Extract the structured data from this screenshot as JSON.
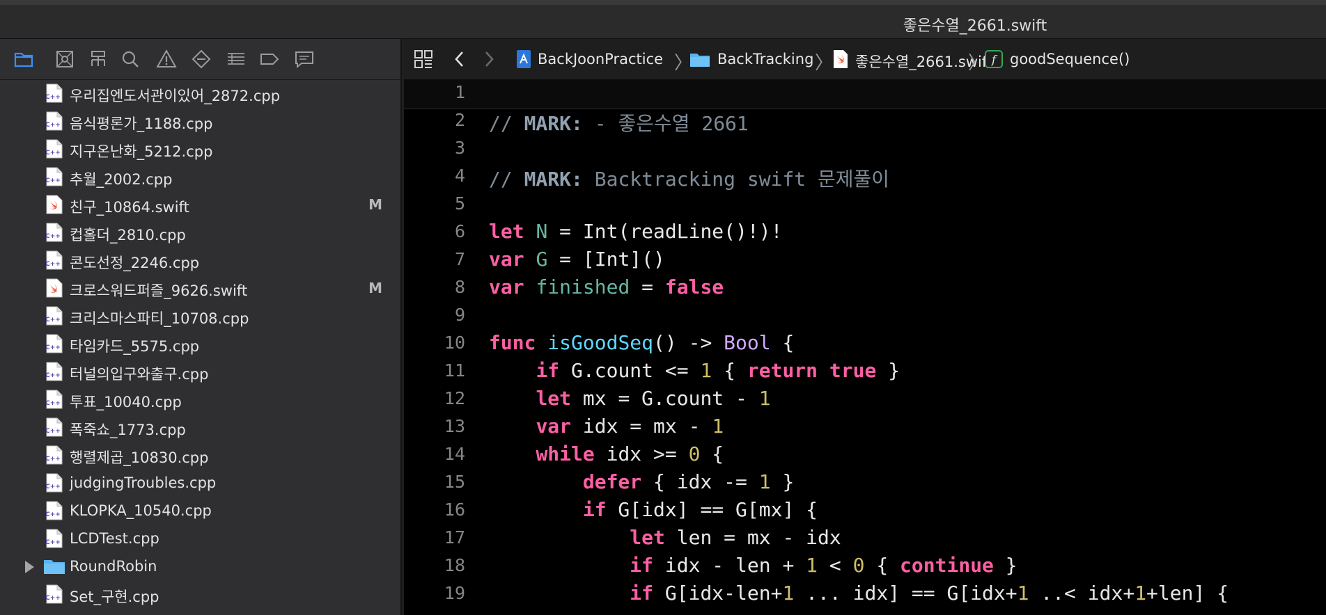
{
  "window": {
    "title": "좋은수열_2661.swift"
  },
  "navigator": {
    "tabs": [
      "project-navigator",
      "source-control-navigator",
      "symbol-navigator",
      "find-navigator",
      "issue-navigator",
      "test-navigator",
      "debug-navigator",
      "breakpoint-navigator",
      "report-navigator"
    ],
    "files": [
      {
        "name": "우리집엔도서관이있어_2872.cpp",
        "type": "cpp",
        "badge": ""
      },
      {
        "name": "음식평론가_1188.cpp",
        "type": "cpp",
        "badge": ""
      },
      {
        "name": "지구온난화_5212.cpp",
        "type": "cpp",
        "badge": ""
      },
      {
        "name": "추월_2002.cpp",
        "type": "cpp",
        "badge": ""
      },
      {
        "name": "친구_10864.swift",
        "type": "swift",
        "badge": "M"
      },
      {
        "name": "컵홀더_2810.cpp",
        "type": "cpp",
        "badge": ""
      },
      {
        "name": "콘도선정_2246.cpp",
        "type": "cpp",
        "badge": ""
      },
      {
        "name": "크로스워드퍼즐_9626.swift",
        "type": "swift",
        "badge": "M"
      },
      {
        "name": "크리스마스파티_10708.cpp",
        "type": "cpp",
        "badge": ""
      },
      {
        "name": "타임카드_5575.cpp",
        "type": "cpp",
        "badge": ""
      },
      {
        "name": "터널의입구와출구.cpp",
        "type": "cpp",
        "badge": ""
      },
      {
        "name": "투표_10040.cpp",
        "type": "cpp",
        "badge": ""
      },
      {
        "name": "폭죽쇼_1773.cpp",
        "type": "cpp",
        "badge": ""
      },
      {
        "name": "행렬제곱_10830.cpp",
        "type": "cpp",
        "badge": ""
      },
      {
        "name": "judgingTroubles.cpp",
        "type": "cpp",
        "badge": ""
      },
      {
        "name": "KLOPKA_10540.cpp",
        "type": "cpp",
        "badge": ""
      },
      {
        "name": "LCDTest.cpp",
        "type": "cpp",
        "badge": ""
      },
      {
        "name": "RoundRobin",
        "type": "folder",
        "badge": ""
      },
      {
        "name": "Set_구현.cpp",
        "type": "cpp",
        "badge": ""
      }
    ]
  },
  "jumpbar": {
    "project": "BackJoonPractice",
    "group": "BackTracking",
    "file": "좋은수열_2661.swift",
    "symbol": "goodSequence()"
  },
  "editor": {
    "lines": [
      {
        "num": "1",
        "tokens": []
      },
      {
        "num": "2",
        "tokens": [
          [
            "c",
            "// "
          ],
          [
            "m",
            "MARK:"
          ],
          [
            "c",
            " - 좋은수열 2661"
          ]
        ]
      },
      {
        "num": "3",
        "tokens": []
      },
      {
        "num": "4",
        "tokens": [
          [
            "c",
            "// "
          ],
          [
            "m",
            "MARK:"
          ],
          [
            "c",
            " Backtracking swift 문제풀이"
          ]
        ]
      },
      {
        "num": "5",
        "tokens": []
      },
      {
        "num": "6",
        "tokens": [
          [
            "k",
            "let"
          ],
          [
            "p",
            " "
          ],
          [
            "v",
            "N"
          ],
          [
            "p",
            " = Int(readLine()!)!"
          ]
        ]
      },
      {
        "num": "7",
        "tokens": [
          [
            "k",
            "var"
          ],
          [
            "p",
            " "
          ],
          [
            "v",
            "G"
          ],
          [
            "p",
            " = [Int]()"
          ]
        ]
      },
      {
        "num": "8",
        "tokens": [
          [
            "k",
            "var"
          ],
          [
            "p",
            " "
          ],
          [
            "v",
            "finished"
          ],
          [
            "p",
            " = "
          ],
          [
            "k",
            "false"
          ]
        ]
      },
      {
        "num": "9",
        "tokens": []
      },
      {
        "num": "10",
        "tokens": [
          [
            "k",
            "func"
          ],
          [
            "p",
            " "
          ],
          [
            "f",
            "isGoodSeq"
          ],
          [
            "p",
            "() -> "
          ],
          [
            "t",
            "Bool"
          ],
          [
            "p",
            " {"
          ]
        ]
      },
      {
        "num": "11",
        "tokens": [
          [
            "p",
            "    "
          ],
          [
            "k",
            "if"
          ],
          [
            "p",
            " G.count <= "
          ],
          [
            "n",
            "1"
          ],
          [
            "p",
            " { "
          ],
          [
            "k",
            "return"
          ],
          [
            "p",
            " "
          ],
          [
            "k",
            "true"
          ],
          [
            "p",
            " }"
          ]
        ]
      },
      {
        "num": "12",
        "tokens": [
          [
            "p",
            "    "
          ],
          [
            "k",
            "let"
          ],
          [
            "p",
            " mx = G.count - "
          ],
          [
            "n",
            "1"
          ]
        ]
      },
      {
        "num": "13",
        "tokens": [
          [
            "p",
            "    "
          ],
          [
            "k",
            "var"
          ],
          [
            "p",
            " idx = mx - "
          ],
          [
            "n",
            "1"
          ]
        ]
      },
      {
        "num": "14",
        "tokens": [
          [
            "p",
            "    "
          ],
          [
            "k",
            "while"
          ],
          [
            "p",
            " idx >= "
          ],
          [
            "n",
            "0"
          ],
          [
            "p",
            " {"
          ]
        ]
      },
      {
        "num": "15",
        "tokens": [
          [
            "p",
            "        "
          ],
          [
            "k",
            "defer"
          ],
          [
            "p",
            " { idx -= "
          ],
          [
            "n",
            "1"
          ],
          [
            "p",
            " }"
          ]
        ]
      },
      {
        "num": "16",
        "tokens": [
          [
            "p",
            "        "
          ],
          [
            "k",
            "if"
          ],
          [
            "p",
            " G[idx] == G[mx] {"
          ]
        ]
      },
      {
        "num": "17",
        "tokens": [
          [
            "p",
            "            "
          ],
          [
            "k",
            "let"
          ],
          [
            "p",
            " len = mx - idx"
          ]
        ]
      },
      {
        "num": "18",
        "tokens": [
          [
            "p",
            "            "
          ],
          [
            "k",
            "if"
          ],
          [
            "p",
            " idx - len + "
          ],
          [
            "n",
            "1"
          ],
          [
            "p",
            " < "
          ],
          [
            "n",
            "0"
          ],
          [
            "p",
            " { "
          ],
          [
            "k",
            "continue"
          ],
          [
            "p",
            " }"
          ]
        ]
      },
      {
        "num": "19",
        "tokens": [
          [
            "p",
            "            "
          ],
          [
            "k",
            "if"
          ],
          [
            "p",
            " G[idx-len+"
          ],
          [
            "n",
            "1"
          ],
          [
            "p",
            " ... idx] == G[idx+"
          ],
          [
            "n",
            "1"
          ],
          [
            "p",
            " ..< idx+"
          ],
          [
            "n",
            "1"
          ],
          [
            "p",
            "+len] {"
          ]
        ]
      }
    ]
  }
}
